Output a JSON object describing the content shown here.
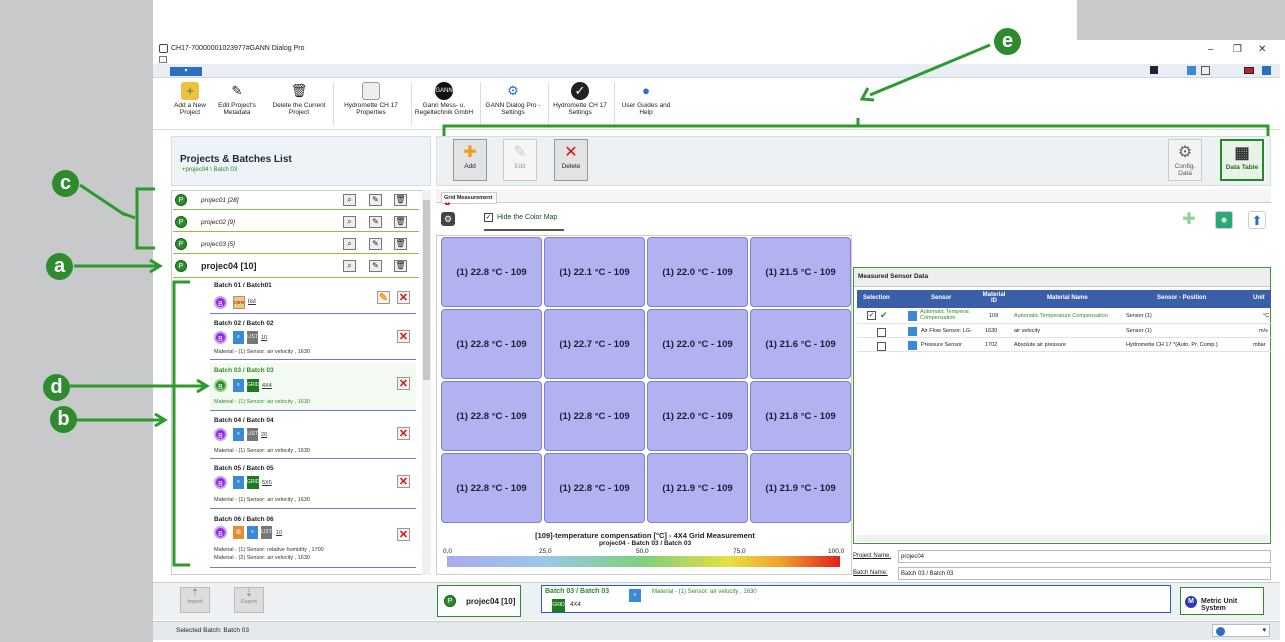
{
  "window": {
    "title": "CH17-70000001023977#GANN Dialog Pro"
  },
  "ribbon": [
    {
      "label": "Add a New Project",
      "icon": "folder-add-icon"
    },
    {
      "label": "Edit Project's Metadata",
      "icon": "pencil-icon"
    },
    {
      "label": "Delete the Current Project",
      "icon": "trash-icon"
    },
    {
      "label": "Hydromette CH 17 Properties",
      "icon": "device-icon"
    },
    {
      "label": "Gann Mess- u. Regeltechnik GmbH",
      "icon": "gann-logo-icon"
    },
    {
      "label": "GANN Dialog Pro - Settings",
      "icon": "gear-icon"
    },
    {
      "label": "Hydromette CH 17 Settings",
      "icon": "wrench-icon"
    },
    {
      "label": "User Guides and Help",
      "icon": "help-icon"
    }
  ],
  "left_header": {
    "title": "Projects & Batches List",
    "path": "+projec04 \\ Batch 03"
  },
  "toolbar": {
    "add": "Add",
    "edit": "Edit",
    "delete": "Delete",
    "config": "Config. Data",
    "data_table": "Data Table"
  },
  "projects": [
    {
      "name": "projec01 [28]"
    },
    {
      "name": "projec02 [9]"
    },
    {
      "name": "projec03 [5]"
    },
    {
      "name": "projec04 [10]"
    }
  ],
  "batches": [
    {
      "title": "Batch 01 / Batch01",
      "tag": "list",
      "meta": ""
    },
    {
      "title": "Batch 02 / Batch 02",
      "tag": "10",
      "meta": "Material - (1) Sensor: air velocity , 1630"
    },
    {
      "title": "Batch 03 / Batch 03",
      "tag": "4X4",
      "meta": "Material - (1) Sensor: air velocity , 1630"
    },
    {
      "title": "Batch 04 / Batch 04",
      "tag": "20",
      "meta": "Material - (1) Sensor: air velocity , 1630"
    },
    {
      "title": "Batch 05 / Batch 05",
      "tag": "5X5",
      "meta": "Material - (1) Sensor: air velocity , 1630"
    },
    {
      "title": "Batch 06 / Batch 06",
      "tag": "10",
      "meta": "Material - (1) Sensor: relative humidity , 1700",
      "meta2": "Material - (2) Sensor: air velocity , 1630"
    }
  ],
  "grid_tab": {
    "label": "Grid Measurement"
  },
  "hide_color_map": "Hide the Color Map",
  "grid_cells": [
    "(1) 22.8 °C - 109",
    "(1) 22.1 °C - 109",
    "(1) 22.0 °C - 109",
    "(1) 21.5 °C - 109",
    "(1) 22.8 °C - 109",
    "(1) 22.7 °C - 109",
    "(1) 22.0 °C - 109",
    "(1) 21.6 °C - 109",
    "(1) 22.8 °C - 109",
    "(1) 22.8 °C - 109",
    "(1) 22.0 °C - 109",
    "(1) 21.8 °C - 109",
    "(1) 22.8 °C - 109",
    "(1) 22.8 °C - 109",
    "(1) 21.9 °C - 109",
    "(1) 21.9 °C - 109"
  ],
  "legend": {
    "title": "[109]-temperature compensation [°C] - 4X4 Grid Measurement",
    "subtitle": "projec04 - Batch 03 / Batch 03",
    "ticks": [
      "0,0",
      "25,0",
      "50,0",
      "75,0",
      "100,0"
    ]
  },
  "sensor_data": {
    "title": "Measured Sensor Data",
    "headers": [
      "Selection",
      "Sensor",
      "Material ID",
      "Material Name",
      "Sensor - Position",
      "Unit"
    ],
    "rows": [
      {
        "sensor": "Automatic Temperat Compensation",
        "id": "109",
        "material": "Automatic Temperature Compensation",
        "position": "Sensor (1)",
        "unit": "°C",
        "checked": true
      },
      {
        "sensor": "Air Flow Sensor: LG-",
        "id": "1630",
        "material": "air velocity",
        "position": "Sensor (1)",
        "unit": "m/s",
        "checked": false
      },
      {
        "sensor": "Pressure Sensor",
        "id": "1702",
        "material": "Absolute air pressure",
        "position": "Hydromette CH 17 *(Auto. Pr. Comp.)",
        "unit": "mbar",
        "checked": false
      }
    ],
    "project_name_label": "Project Name:",
    "project_name": "projec04",
    "batch_name_label": "Batch Name:",
    "batch_name": "Batch 03 / Batch 03"
  },
  "bottom": {
    "import": "Import",
    "export": "Export",
    "project": "projec04 [10]",
    "batch": "Batch 03 / Batch 03",
    "batch_tag": "4X4",
    "batch_meta": "Material - (1) Sensor: air velocity , 1630",
    "unit_system": "Metric Unit System"
  },
  "status": {
    "text": "Selected Batch: Batch 03"
  },
  "callouts": [
    "a",
    "b",
    "c",
    "d",
    "e"
  ]
}
